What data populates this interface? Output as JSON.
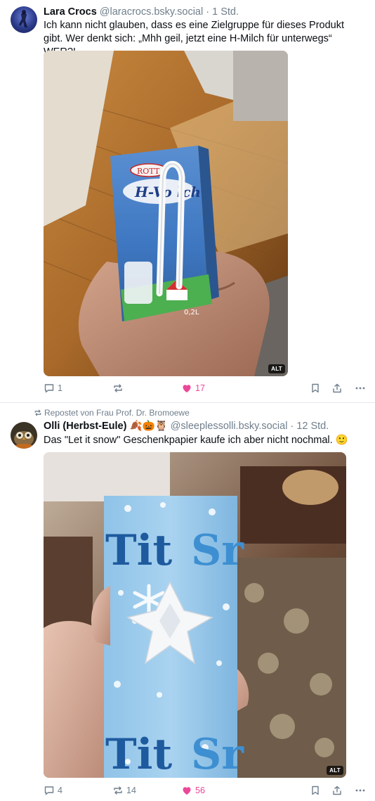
{
  "post1": {
    "display_name": "Lara Crocs",
    "handle": "@laracrocs.bsky.social",
    "separator": "·",
    "time": "1 Std.",
    "text": "Ich kann nicht glauben, dass es eine Zielgruppe für dieses Produkt gibt. Wer denkt sich: „Mhh geil, jetzt eine H-Milch für unterwegs“ WER?!",
    "image_alt_badge": "ALT",
    "carton_brand": "ROTT",
    "carton_label": "H-Vo    lch",
    "carton_volume": "0,2L",
    "reply_count": "1",
    "repost_count": "",
    "like_count": "17",
    "liked": true
  },
  "post2": {
    "repost_label": "Repostet von Frau Prof. Dr. Bromoewe",
    "display_name": "Olli (Herbst-Eule) 🍂🎃🦉",
    "handle": "@sleeplessolli.bsky.social",
    "separator": "·",
    "time": "12 Std.",
    "text": "Das \"Let it snow\" Geschenkpapier kaufe ich aber nicht nochmal. 🙂",
    "image_alt_badge": "ALT",
    "paper_text_a": "Tit",
    "paper_text_b": "Sr",
    "reply_count": "4",
    "repost_count": "14",
    "like_count": "56",
    "liked": true
  },
  "colors": {
    "like_active": "#ec4899",
    "muted": "#6f7e8c",
    "text": "#0b0f14",
    "divider": "#e4e8ec"
  },
  "icons": {
    "reply": "speech-bubble-icon",
    "repost": "repost-arrows-icon",
    "like": "heart-icon",
    "bookmark": "bookmark-icon",
    "share": "share-icon",
    "more": "ellipsis-icon"
  }
}
